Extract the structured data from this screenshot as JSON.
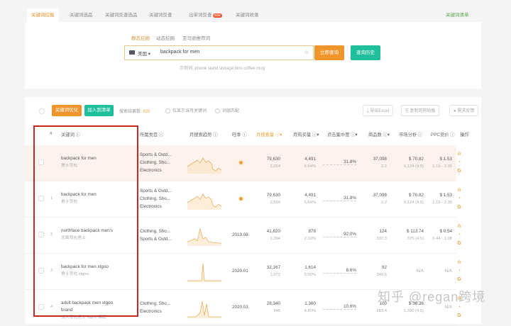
{
  "top_tabs": [
    {
      "label": "关键词挖掘",
      "active": true
    },
    {
      "label": "关键词选品"
    },
    {
      "label": "关键词反查选品"
    },
    {
      "label": "关键词反查"
    },
    {
      "label": "出单词反查",
      "badge": "new"
    },
    {
      "label": "关键词收录"
    }
  ],
  "keyword_list_link": "关键词清单",
  "search": {
    "modes": [
      "静态挖掘",
      "动态挖掘",
      "亚马逊推荐词"
    ],
    "country": "美国",
    "value": "backpack for men",
    "query_button": "立即查询",
    "history_button": "查询历史",
    "examples_label": "示例词:",
    "examples": [
      "phone stand",
      "storage bins",
      "coffee mug"
    ]
  },
  "toolbar": {
    "optimize_button": "关键词优化",
    "add_button": "加入到清单",
    "result_label": "搜索结果数:",
    "result_count": "820",
    "filter1": "仅显示当月关键词",
    "filter2": "词组匹配",
    "export": "导出Excel",
    "copy": "复制到剪贴板",
    "feedback": "需求反馈"
  },
  "columns": [
    "#",
    "关键词 ⓘ",
    "所属类目 ⓘ",
    "月搜索趋势 ⓘ",
    "旺季 ⓘ",
    "月搜索量 ⓘ▾",
    "月购买量 ⓘ▾",
    "点击集中度 ⓘ▾",
    "商品数 ⓘ▾",
    "市场分析 ⓘ",
    "PPC竞价 ⓘ",
    "操作"
  ],
  "rows": [
    {
      "idx": "",
      "kw": "backpack for men",
      "kw_cn": "男士背包",
      "cats": [
        "Sports & Outd...",
        "Clothing, Sho...",
        "Electronics"
      ],
      "season": "",
      "search": "79,630",
      "search_sub": "2,654",
      "buy": "4,491",
      "buy_sub": "5.64%",
      "click": "31.8%",
      "products": "37,098",
      "products_sub": "2.2",
      "market": "$ 70.82",
      "market_sub": "6,124 (4.5)",
      "ppc": "$ 1.53",
      "ppc_sub": "1.19 - 2.35"
    },
    {
      "idx": "1",
      "kw": "backpack for men",
      "kw_cn": "男士背包",
      "cats": [
        "Sports & Outd...",
        "Clothing, Sho...",
        "Electronics"
      ],
      "season": "",
      "search": "79,630",
      "search_sub": "2,654",
      "buy": "4,491",
      "buy_sub": "5.64%",
      "click": "31.8%",
      "products": "37,098",
      "products_sub": "2.2",
      "market": "$ 70.82",
      "market_sub": "6,124 (4.5)",
      "ppc": "$ 1.53",
      "ppc_sub": "1.19 - 2.35"
    },
    {
      "idx": "2",
      "kw": "northface backpack men's",
      "kw_cn": "北面背包男士",
      "cats": [
        "Clothing, Sho...",
        "Sports & Outd..."
      ],
      "season": "2019.08",
      "search": "41,820",
      "search_sub": "1,394",
      "buy": "878",
      "buy_sub": "2.10%",
      "click": "92.0%",
      "products": "124",
      "products_sub": "337.3",
      "market": "$ 113.74",
      "market_sub": "575 (4.5)",
      "ppc": "$ 0.54",
      "ppc_sub": "0.44 - 1.08"
    },
    {
      "idx": "3",
      "kw": "backpack for men xtgoo",
      "kw_cn": "男士背包 xtgoo",
      "cats": [],
      "season": "2020.01",
      "search": "32,167",
      "search_sub": "1,072",
      "buy": "1,614",
      "buy_sub": "5.02%",
      "click": "8.6%",
      "products": "92",
      "products_sub": "349.6",
      "market": "N/A",
      "market_sub": "",
      "ppc": "N/A",
      "ppc_sub": ""
    },
    {
      "idx": "4",
      "kw": "adult backpack men xtgoo brand",
      "kw_cn": "成人背包男士 xtgoo 品牌",
      "cats": [
        "Clothing, Sho...",
        "Electronics"
      ],
      "season": "2020.03",
      "search": "28,340",
      "search_sub": "945",
      "buy": "1,360",
      "buy_sub": "4.80%",
      "click": "10.6%",
      "products": "100",
      "products_sub": "283.4",
      "market": "$ 38.36",
      "market_sub": "1,330 (4.5)",
      "ppc": "N/A",
      "ppc_sub": ""
    }
  ],
  "watermark": "知乎 @regan跨境"
}
